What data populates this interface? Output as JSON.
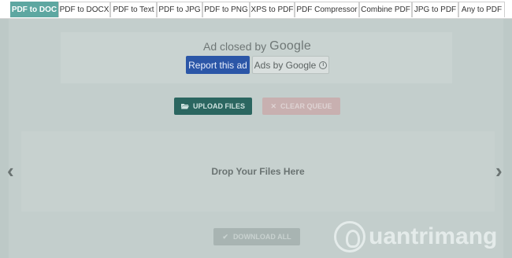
{
  "tabs": [
    {
      "label": "PDF to DOC",
      "active": true
    },
    {
      "label": "PDF to DOCX",
      "active": false
    },
    {
      "label": "PDF to Text",
      "active": false
    },
    {
      "label": "PDF to JPG",
      "active": false
    },
    {
      "label": "PDF to PNG",
      "active": false
    },
    {
      "label": "XPS to PDF",
      "active": false
    },
    {
      "label": "PDF Compressor",
      "active": false
    },
    {
      "label": "Combine PDF",
      "active": false
    },
    {
      "label": "JPG to PDF",
      "active": false
    },
    {
      "label": "Any to PDF",
      "active": false
    }
  ],
  "ad": {
    "closed_by": "Ad closed by",
    "brand": "Google",
    "report_label": "Report this ad",
    "ads_by_label": "Ads by Google",
    "info_icon": "info-icon"
  },
  "actions": {
    "upload_label": "UPLOAD FILES",
    "upload_icon": "folder-open-icon",
    "clear_label": "CLEAR QUEUE",
    "clear_icon": "close-icon",
    "download_label": "DOWNLOAD ALL",
    "download_icon": "check-icon"
  },
  "dropzone": {
    "text": "Drop Your Files Here",
    "prev_icon": "chevron-left-icon",
    "next_icon": "chevron-right-icon"
  },
  "watermark": {
    "text": "uantrimang"
  },
  "colors": {
    "active_tab": "#5ea7a1",
    "report_button": "#2b56a7",
    "upload_button": "#2b6660",
    "overlay_background": "#bdc9c7"
  }
}
